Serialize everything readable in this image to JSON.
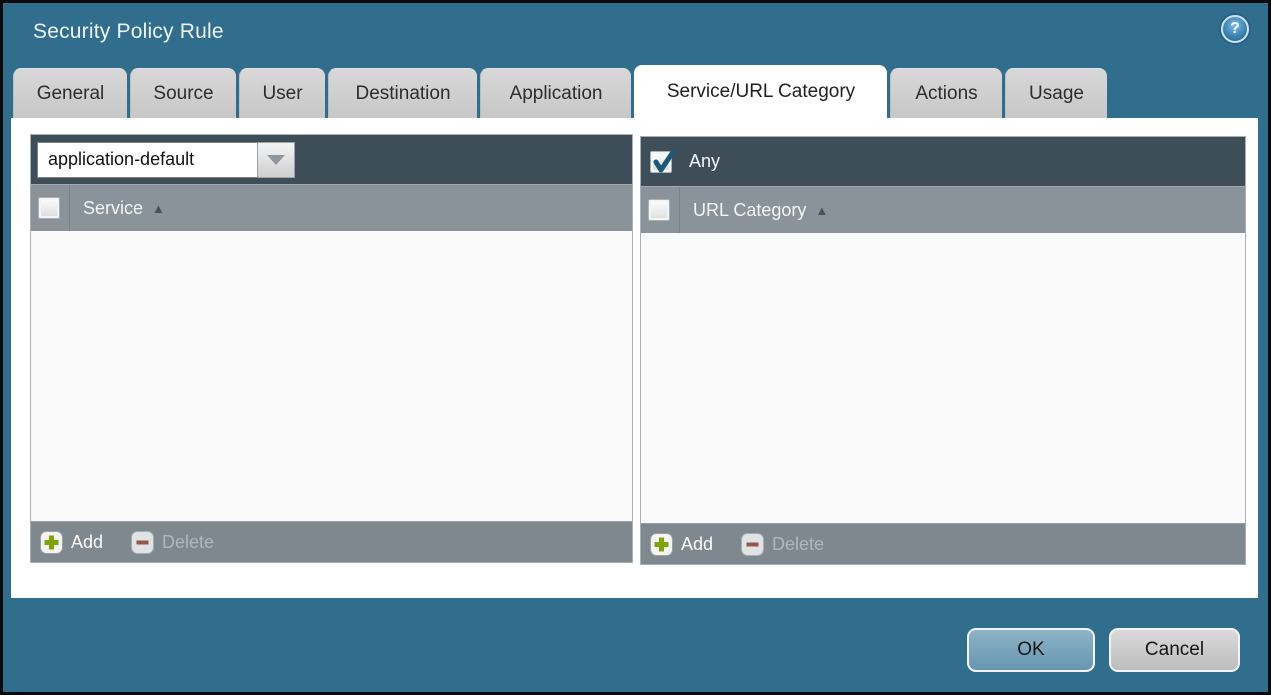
{
  "window": {
    "title": "Security Policy Rule"
  },
  "help": {
    "glyph": "?"
  },
  "tabs": [
    {
      "label": "General",
      "active": false
    },
    {
      "label": "Source",
      "active": false
    },
    {
      "label": "User",
      "active": false
    },
    {
      "label": "Destination",
      "active": false
    },
    {
      "label": "Application",
      "active": false
    },
    {
      "label": "Service/URL Category",
      "active": true
    },
    {
      "label": "Actions",
      "active": false
    },
    {
      "label": "Usage",
      "active": false
    }
  ],
  "service_panel": {
    "selector_value": "application-default",
    "column_header": "Service",
    "sort_glyph": "▲",
    "header_checkbox_checked": false,
    "rows": [],
    "add_label": "Add",
    "delete_label": "Delete",
    "delete_enabled": false
  },
  "url_panel": {
    "any_label": "Any",
    "any_checked": true,
    "column_header": "URL Category",
    "sort_glyph": "▲",
    "header_checkbox_checked": false,
    "rows": [],
    "add_label": "Add",
    "delete_label": "Delete",
    "delete_enabled": false
  },
  "actions": {
    "ok_label": "OK",
    "cancel_label": "Cancel"
  },
  "colors": {
    "dialog_chrome": "#316d8c",
    "panel_toolbar": "#3e4e58",
    "column_header": "#8a9399",
    "panel_footer": "#7e888e",
    "tab_inactive": "#cdcdcd",
    "tab_active": "#ffffff",
    "ok_button": "#6fa1ba",
    "cancel_button": "#c9c9c9",
    "add_icon_green": "#7fa30a",
    "delete_icon_red": "#96564a",
    "checkmark_blue": "#1e5876"
  }
}
